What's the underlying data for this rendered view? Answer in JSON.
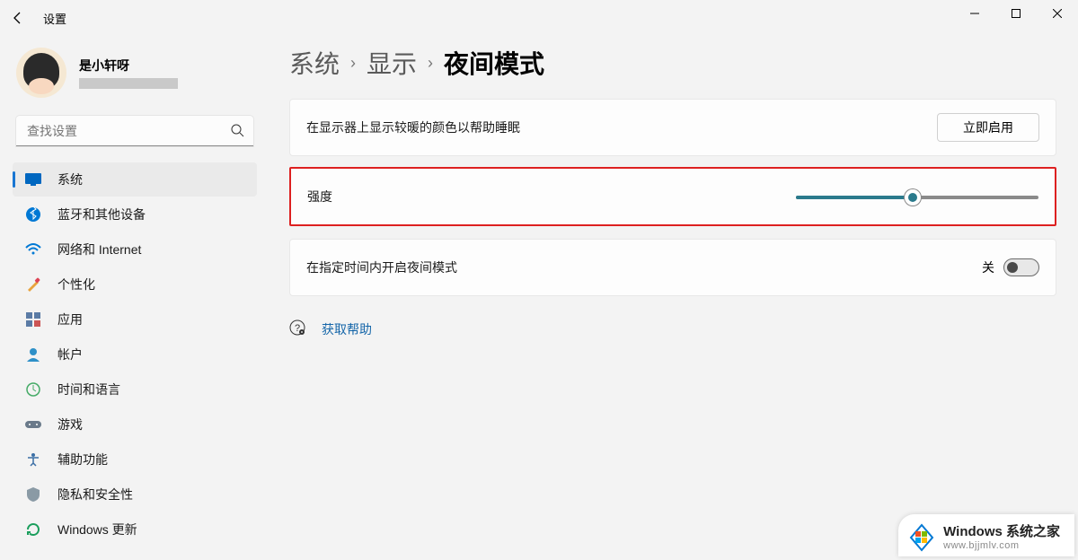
{
  "titlebar": {
    "title": "设置"
  },
  "profile": {
    "name": "是小轩呀"
  },
  "search": {
    "placeholder": "查找设置"
  },
  "nav": {
    "items": [
      {
        "label": "系统"
      },
      {
        "label": "蓝牙和其他设备"
      },
      {
        "label": "网络和 Internet"
      },
      {
        "label": "个性化"
      },
      {
        "label": "应用"
      },
      {
        "label": "帐户"
      },
      {
        "label": "时间和语言"
      },
      {
        "label": "游戏"
      },
      {
        "label": "辅助功能"
      },
      {
        "label": "隐私和安全性"
      },
      {
        "label": "Windows 更新"
      }
    ]
  },
  "breadcrumb": {
    "l1": "系统",
    "l2": "显示",
    "current": "夜间模式"
  },
  "rows": {
    "r1": {
      "label": "在显示器上显示较暖的颜色以帮助睡眠",
      "button": "立即启用"
    },
    "r2": {
      "label": "强度",
      "value": 48
    },
    "r3": {
      "label": "在指定时间内开启夜间模式",
      "toggle_label": "关",
      "toggle_on": false
    }
  },
  "help": {
    "label": "获取帮助"
  },
  "watermark": {
    "title": "Windows 系统之家",
    "sub": "www.bjjmlv.com"
  }
}
